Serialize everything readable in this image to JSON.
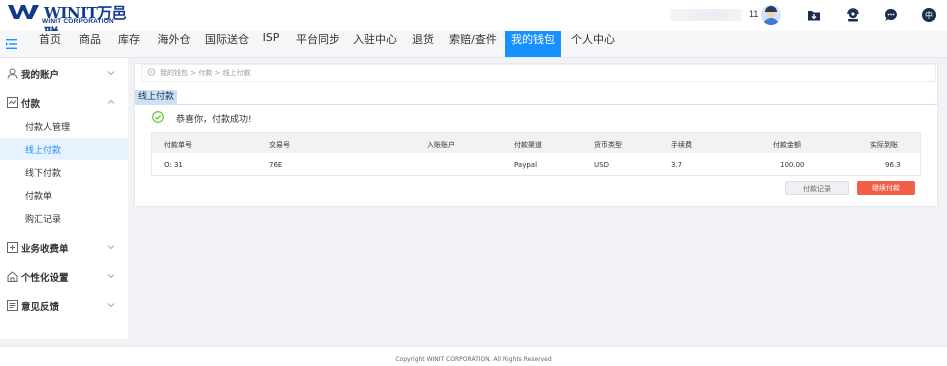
{
  "header": {
    "brand": "WINIT万邑联",
    "brand_sub": "WINIT CORPORATION",
    "user_name": "11"
  },
  "nav": {
    "items": [
      "首页",
      "商品",
      "库存",
      "海外仓",
      "国际送仓",
      "ISP",
      "平台同步",
      "入驻中心",
      "退货",
      "索赔/查件",
      "我的钱包",
      "个人中心"
    ],
    "active": "我的钱包"
  },
  "sidebar": {
    "groups": [
      {
        "label": "我的账户",
        "icon": "user-icon"
      },
      {
        "label": "付款",
        "icon": "payment-icon",
        "expanded": true,
        "items": [
          "付款人管理",
          "线上付款",
          "线下付款",
          "付款单",
          "购汇记录"
        ],
        "active": "线上付款"
      },
      {
        "label": "业务收费单",
        "icon": "bill-icon"
      },
      {
        "label": "个性化设置",
        "icon": "home-icon"
      },
      {
        "label": "意见反馈",
        "icon": "feedback-icon"
      }
    ]
  },
  "breadcrumb": "我的钱包 > 付款 > 线上付款",
  "panel": {
    "tab": "线上付款",
    "success_message": "恭喜你，付款成功!"
  },
  "table": {
    "headers": [
      "付款单号",
      "交易号",
      "入账账户",
      "付款渠道",
      "货币类型",
      "手续费",
      "付款金额",
      "实际到账"
    ],
    "row": [
      "O:          31",
      "76E",
      "",
      "Paypal",
      "USD",
      "3.7",
      "100.00",
      "96.3"
    ]
  },
  "buttons": {
    "records": "付款记录",
    "continue": "继续付款"
  },
  "footer": "Copyright WINIT CORPORATION. All Rights Reserved",
  "colors": {
    "primary": "#1890ff",
    "brand": "#123a8c",
    "danger_button": "#f25e45",
    "success": "#52c41a"
  }
}
